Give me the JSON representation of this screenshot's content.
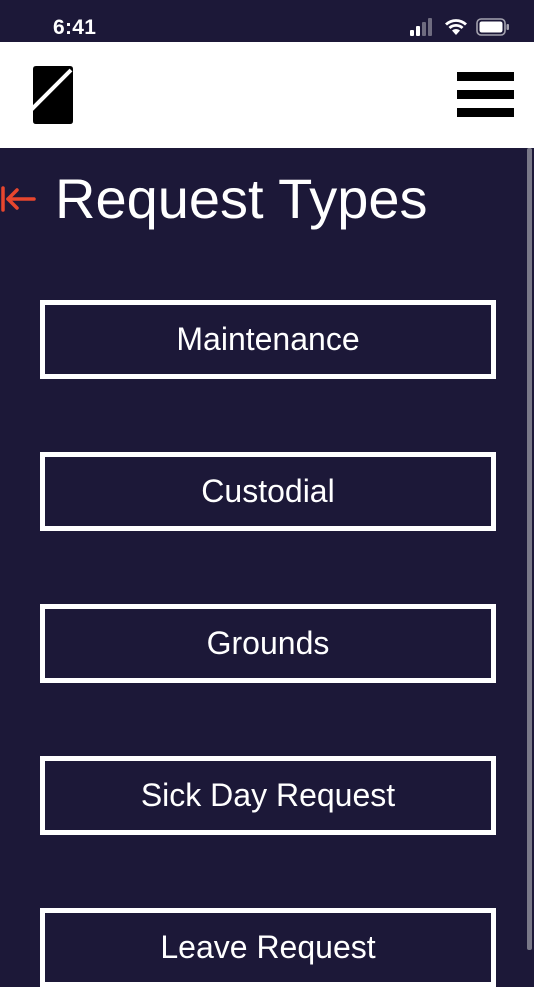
{
  "status_bar": {
    "time": "6:41",
    "icons": [
      "cellular-signal-icon",
      "wifi-icon",
      "battery-icon"
    ]
  },
  "header": {
    "logo_icon": "brand-logo-icon",
    "menu_icon": "hamburger-menu-icon"
  },
  "page": {
    "back_icon": "back-arrow-icon",
    "title": "Request Types"
  },
  "request_types": [
    {
      "label": "Maintenance"
    },
    {
      "label": "Custodial"
    },
    {
      "label": "Grounds"
    },
    {
      "label": "Sick Day Request"
    },
    {
      "label": "Leave Request"
    }
  ],
  "colors": {
    "background": "#1c1838",
    "header_background": "#ffffff",
    "accent": "#e8462e",
    "text": "#ffffff"
  }
}
